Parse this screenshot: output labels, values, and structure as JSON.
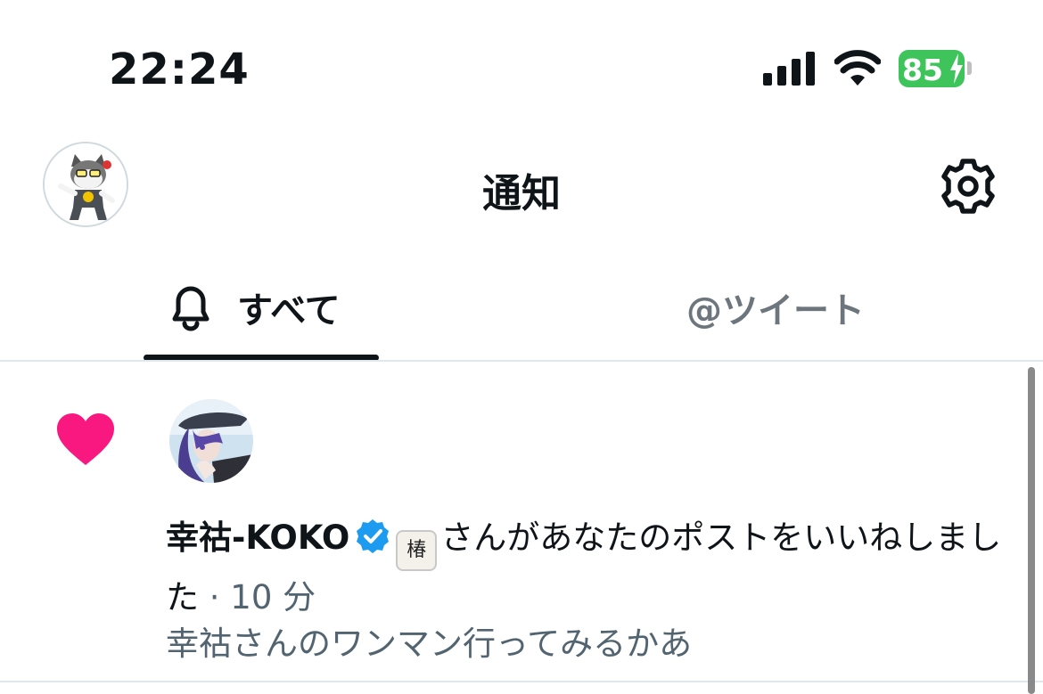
{
  "status_bar": {
    "time": "22:24",
    "battery_level": "85",
    "battery_charging": true,
    "battery_color": "#3ec45a"
  },
  "header": {
    "title": "通知",
    "profile_avatar": "user-avatar-cartoon-cat",
    "settings_icon": "gear-icon"
  },
  "tabs": [
    {
      "label": "すべて",
      "icon": "bell-icon",
      "selected": true
    },
    {
      "label": "@ツイート",
      "selected": false
    }
  ],
  "notification": {
    "type_icon": "heart-icon",
    "type_color": "#f91880",
    "user_name": "幸祜-KOKO",
    "verified": true,
    "verified_color": "#1d9bf0",
    "badge_text": "椿",
    "message": "さんがあなたのポストをいいねしました",
    "separator": " · ",
    "time_ago": "10 分",
    "post_preview": "幸祜さんのワンマン行ってみるかあ"
  }
}
